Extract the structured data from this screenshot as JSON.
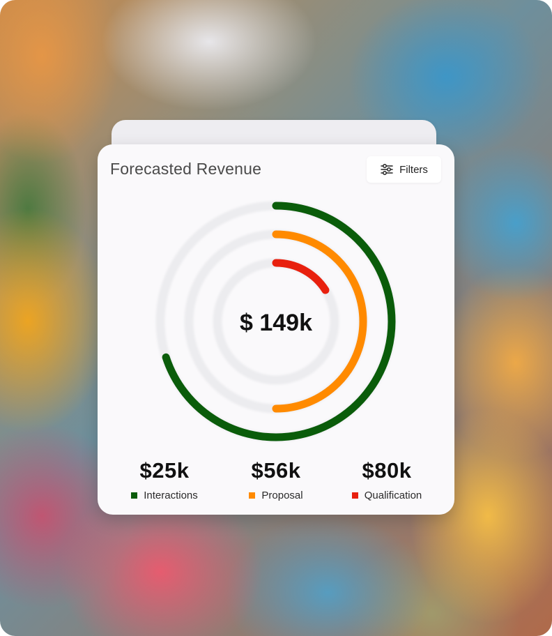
{
  "card": {
    "title": "Forecasted Revenue",
    "filters_label": "Filters"
  },
  "chart_data": {
    "type": "radial-bar",
    "center_label": "$ 149k",
    "series": [
      {
        "name": "Interactions",
        "value": "$25k",
        "fraction": 0.7,
        "color": "#0a5c0a"
      },
      {
        "name": "Proposal",
        "value": "$56k",
        "fraction": 0.5,
        "color": "#ff8a00"
      },
      {
        "name": "Qualification",
        "value": "$80k",
        "fraction": 0.16,
        "color": "#e8200e"
      }
    ],
    "track_color": "#ececef"
  },
  "totals": [
    {
      "value": "$25k",
      "label": "Interactions",
      "color": "#0a5c0a"
    },
    {
      "value": "$56k",
      "label": "Proposal",
      "color": "#ff8a00"
    },
    {
      "value": "$80k",
      "label": "Qualification",
      "color": "#e8200e"
    }
  ]
}
